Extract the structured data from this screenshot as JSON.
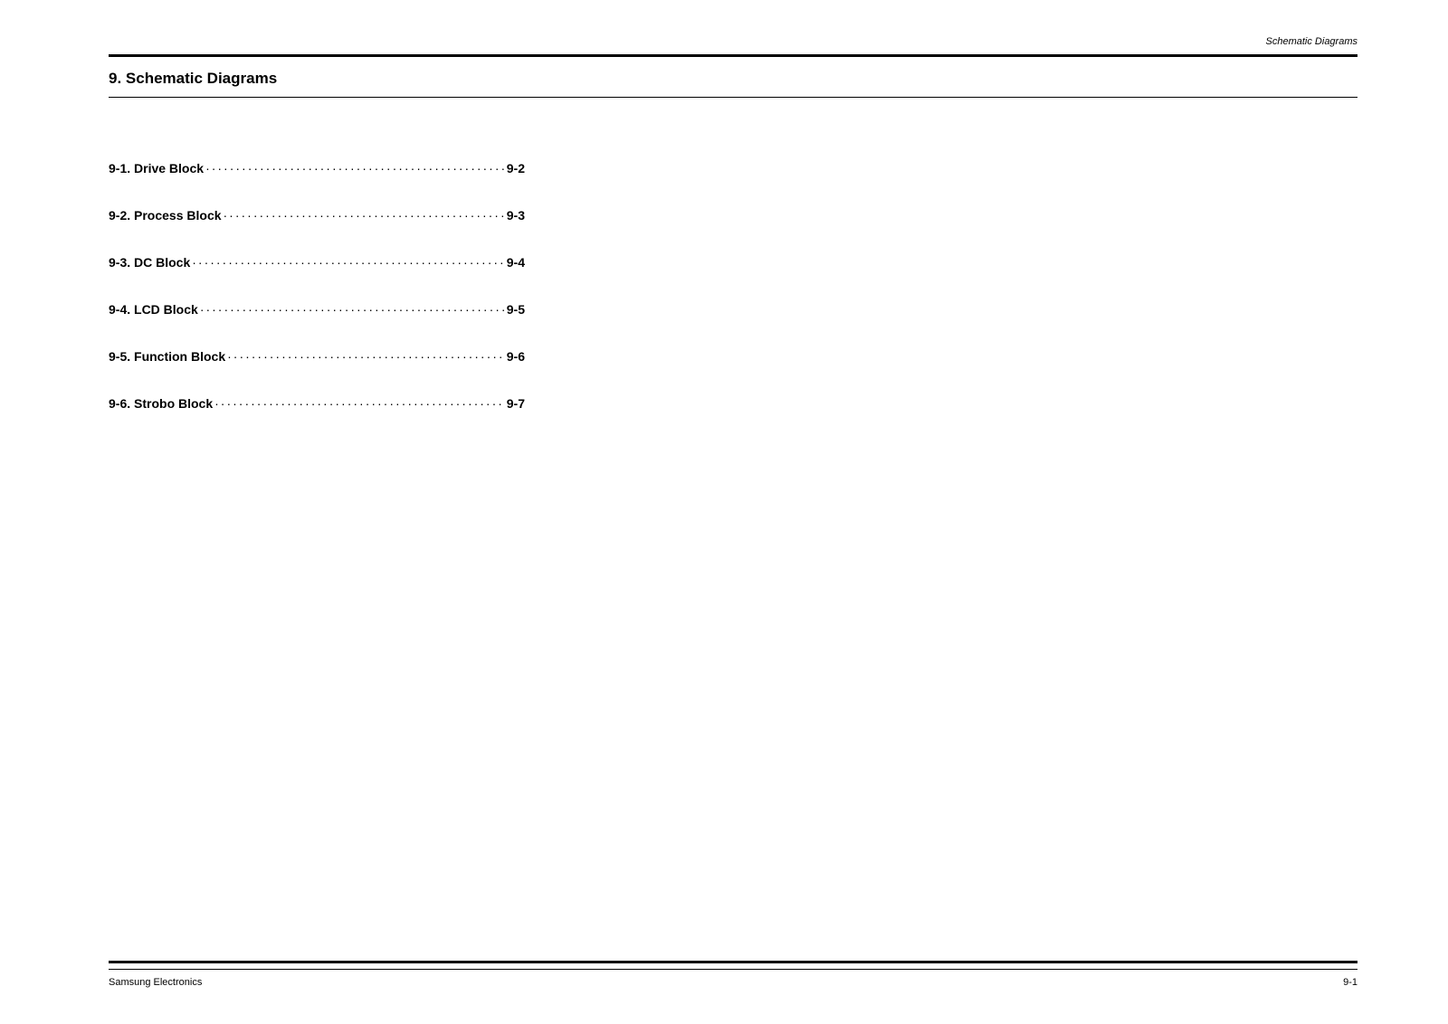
{
  "header": {
    "label": "Schematic Diagrams"
  },
  "section": {
    "title": "9. Schematic Diagrams"
  },
  "toc": {
    "entries": [
      {
        "label": "9-1. Drive Block",
        "page": "9-2"
      },
      {
        "label": "9-2. Process Block",
        "page": "9-3"
      },
      {
        "label": "9-3. DC Block",
        "page": "9-4"
      },
      {
        "label": "9-4. LCD Block",
        "page": "9-5"
      },
      {
        "label": "9-5. Function Block",
        "page": "9-6"
      },
      {
        "label": "9-6. Strobo Block",
        "page": "9-7"
      }
    ]
  },
  "footer": {
    "left": "Samsung Electronics",
    "right": "9-1"
  }
}
